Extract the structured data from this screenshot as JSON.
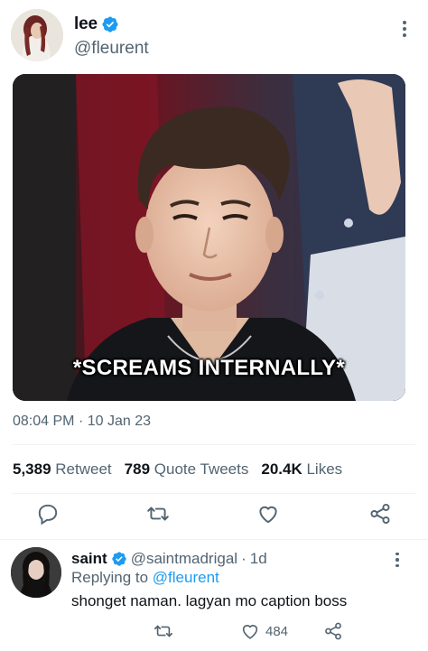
{
  "tweet": {
    "author": {
      "display_name": "lee",
      "handle": "@fleurent",
      "verified": true,
      "avatar_icon": "profile-photo"
    },
    "media": {
      "caption": "*SCREAMS INTERNALLY*"
    },
    "timestamp": "08:04 PM",
    "timestamp_sep": "·",
    "date": "10 Jan 23",
    "stats": {
      "retweets_count": "5,389",
      "retweets_label": "Retweet",
      "quotes_count": "789",
      "quotes_label": "Quote Tweets",
      "likes_count": "20.4K",
      "likes_label": "Likes"
    },
    "actions": [
      "reply-icon",
      "retweet-icon",
      "like-icon",
      "share-icon"
    ]
  },
  "reply": {
    "display_name": "saint",
    "verified": true,
    "handle": "@saintmadrigal",
    "time_sep": "·",
    "time": "1d",
    "replying_prefix": "Replying to",
    "replying_to": "@fleurent",
    "text": "shonget naman. lagyan mo caption boss",
    "likes": "484"
  },
  "colors": {
    "accent": "#1d9bf0",
    "secondary_text": "#536471",
    "primary_text": "#0f1419",
    "divider": "#eff3f4"
  }
}
